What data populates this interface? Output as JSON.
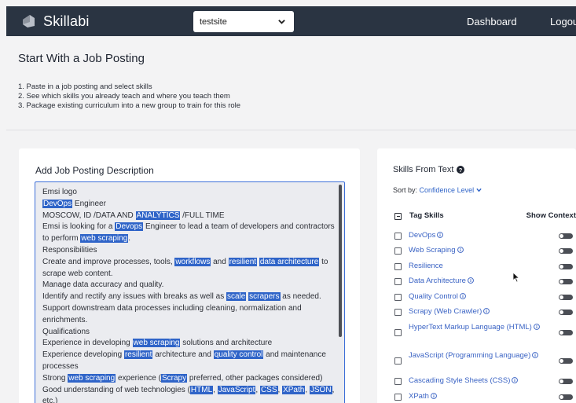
{
  "navbar": {
    "brand": "Skillabi",
    "site_select_value": "testsite",
    "links": {
      "dashboard": "Dashboard",
      "logout": "Logout"
    }
  },
  "page": {
    "title": "Start With a Job Posting",
    "steps": [
      "1. Paste in a job posting and select skills",
      "2. See which skills you already teach and where you teach them",
      "3. Package existing curriculum into a new group to train for this role"
    ]
  },
  "job_posting": {
    "card_title": "Add Job Posting Description",
    "lines": [
      [
        {
          "t": "Emsi logo"
        }
      ],
      [
        {
          "t": "DevOps",
          "h": true
        },
        {
          "t": " Engineer"
        }
      ],
      [
        {
          "t": "MOSCOW, ID /DATA AND "
        },
        {
          "t": "ANALYTICS",
          "h": true
        },
        {
          "t": " /FULL TIME"
        }
      ],
      [
        {
          "t": "Emsi is looking for a "
        },
        {
          "t": "Devops",
          "h": true
        },
        {
          "t": " Engineer to lead a team of developers and contractors to perform "
        },
        {
          "t": "web scraping",
          "h": true
        },
        {
          "t": "."
        }
      ],
      [
        {
          "t": "Responsibilities"
        }
      ],
      [
        {
          "t": "Create and improve processes, tools, "
        },
        {
          "t": "workflows",
          "h": true
        },
        {
          "t": " and "
        },
        {
          "t": "resilient",
          "h": true
        },
        {
          "t": " "
        },
        {
          "t": "data architecture",
          "h": true
        },
        {
          "t": " to scrape web content."
        }
      ],
      [
        {
          "t": "Manage data accuracy and quality."
        }
      ],
      [
        {
          "t": "Identify and rectify any issues with breaks as well as "
        },
        {
          "t": "scale",
          "h": true
        },
        {
          "t": " "
        },
        {
          "t": "scrapers",
          "h": true
        },
        {
          "t": " as needed."
        }
      ],
      [
        {
          "t": "Support downstream data processes including cleaning, normalization and enrichments."
        }
      ],
      [
        {
          "t": "Qualifications"
        }
      ],
      [
        {
          "t": "Experience in developing "
        },
        {
          "t": "web scraping",
          "h": true
        },
        {
          "t": " solutions and architecture"
        }
      ],
      [
        {
          "t": "Experience developing "
        },
        {
          "t": "resilient",
          "h": true
        },
        {
          "t": " architecture and "
        },
        {
          "t": "quality control",
          "h": true
        },
        {
          "t": " and maintenance processes"
        }
      ],
      [
        {
          "t": "Strong "
        },
        {
          "t": "web scraping",
          "h": true
        },
        {
          "t": " experience ("
        },
        {
          "t": "Scrapy",
          "h": true
        },
        {
          "t": " preferred, other packages considered)"
        }
      ],
      [
        {
          "t": "Good understanding of web technologies ("
        },
        {
          "t": "HTML",
          "h": true
        },
        {
          "t": ", "
        },
        {
          "t": "JavaScript",
          "h": true
        },
        {
          "t": ", "
        },
        {
          "t": "CSS",
          "h": true
        },
        {
          "t": ", "
        },
        {
          "t": "XPath",
          "h": true
        },
        {
          "t": ", "
        },
        {
          "t": "JSON",
          "h": true
        },
        {
          "t": ", etc.)"
        }
      ]
    ]
  },
  "skills_panel": {
    "title": "Skills From Text",
    "sort_label": "Sort by:",
    "sort_value": "Confidence Level",
    "tag_skills_label": "Tag Skills",
    "show_context_label": "Show Context",
    "skills": [
      {
        "label": "DevOps"
      },
      {
        "label": "Web Scraping"
      },
      {
        "label": "Resilience",
        "no_info": true
      },
      {
        "label": "Data Architecture"
      },
      {
        "label": "Quality Control"
      },
      {
        "label": "Scrapy (Web Crawler)"
      },
      {
        "label": "HyperText Markup Language (HTML)"
      },
      {
        "label": "JavaScript (Programming Language)"
      },
      {
        "label": "Cascading Style Sheets (CSS)"
      },
      {
        "label": "XPath"
      }
    ]
  },
  "colors": {
    "nav": "#2a3442",
    "accent": "#2f64c8",
    "toggle": "#4b4e55"
  },
  "icons": [
    "logo-icon",
    "chevron-down-icon",
    "help-icon",
    "info-icon",
    "minus-icon",
    "cursor-icon"
  ]
}
